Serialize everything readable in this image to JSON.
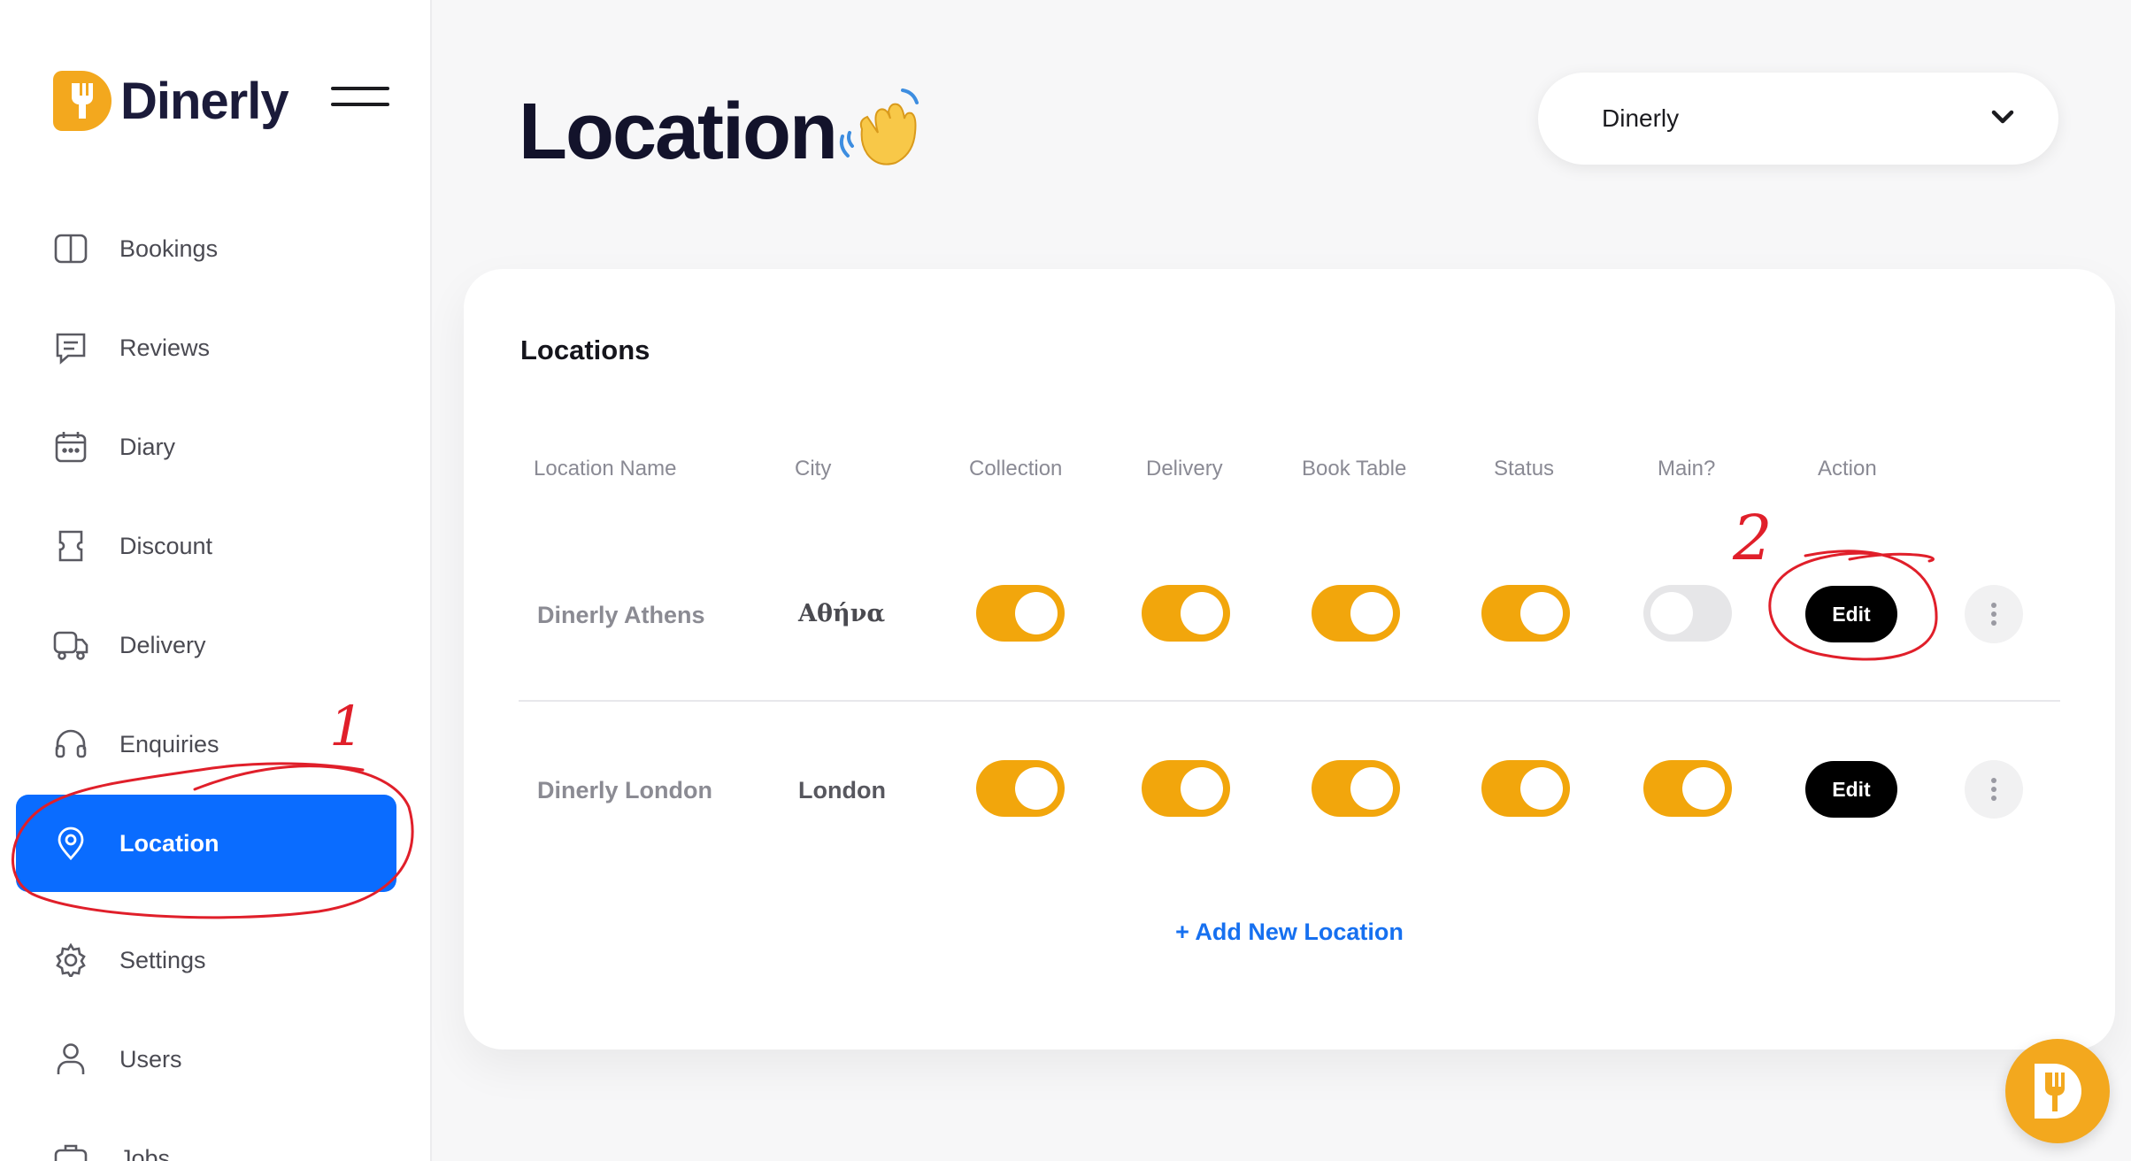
{
  "app": {
    "brand": "Dinerly",
    "accent": "#f2a60c",
    "active_blue": "#0a6cff"
  },
  "sidebar": {
    "items": [
      {
        "label": "Bookings",
        "icon": "book-icon"
      },
      {
        "label": "Reviews",
        "icon": "message-icon"
      },
      {
        "label": "Diary",
        "icon": "calendar-icon"
      },
      {
        "label": "Discount",
        "icon": "ticket-icon"
      },
      {
        "label": "Delivery",
        "icon": "truck-icon"
      },
      {
        "label": "Enquiries",
        "icon": "headset-icon"
      },
      {
        "label": "Location",
        "icon": "map-pin-icon",
        "active": true
      },
      {
        "label": "Settings",
        "icon": "gear-icon"
      },
      {
        "label": "Users",
        "icon": "user-icon"
      },
      {
        "label": "Jobs",
        "icon": "briefcase-icon"
      }
    ]
  },
  "header": {
    "title": "Location",
    "emoji": "waving-hand",
    "org_select": "Dinerly"
  },
  "locations": {
    "title": "Locations",
    "columns": [
      "Location Name",
      "City",
      "Collection",
      "Delivery",
      "Book Table",
      "Status",
      "Main?",
      "Action"
    ],
    "rows": [
      {
        "name": "Dinerly Athens",
        "city": "Αθήνα",
        "collection": true,
        "delivery": true,
        "book_table": true,
        "status": true,
        "main": false,
        "action": "Edit"
      },
      {
        "name": "Dinerly London",
        "city": "London",
        "collection": true,
        "delivery": true,
        "book_table": true,
        "status": true,
        "main": true,
        "action": "Edit"
      }
    ],
    "add_label": "+ Add New Location"
  },
  "annotations": {
    "one": "1",
    "two": "2"
  }
}
